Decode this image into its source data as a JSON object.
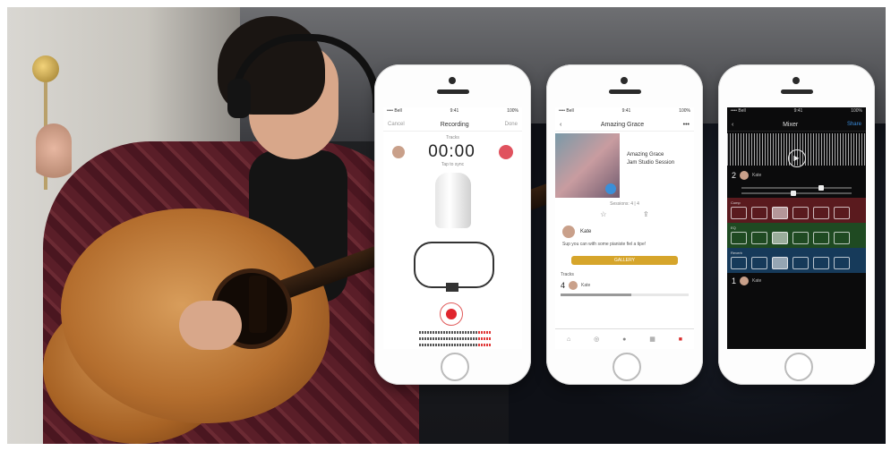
{
  "phone1": {
    "status": {
      "carrier": "•••• Bell",
      "time": "9:41",
      "battery": "100%"
    },
    "nav": {
      "left": "Cancel",
      "title": "Recording",
      "right": "Done"
    },
    "timer_caption": "Tracks",
    "timer": "00:00",
    "timer_sub": "Tap to sync"
  },
  "phone2": {
    "status": {
      "carrier": "•••• Bell",
      "time": "9:41",
      "battery": "100%"
    },
    "nav": {
      "back": "‹",
      "title": "Amazing Grace",
      "subtitle": "Jam Studio Session",
      "more": "•••"
    },
    "song_title": "Amazing Grace",
    "session_name": "Jam Studio Session",
    "plays_line": "Sessions: 4 | 4",
    "user_name": "Kate",
    "comment": "Sup you can with some pianiste fiel a tipe!",
    "gold_button": "GALLERY",
    "tracks_label": "Tracks",
    "track_number": "4",
    "track_user": "Kate",
    "track_progress": 0.55,
    "tabs": [
      "Home",
      "Collaborate",
      "Record",
      "Sessions",
      "Favourites"
    ],
    "active_tab": 4
  },
  "phone3": {
    "status": {
      "carrier": "•••• Bell",
      "time": "9:41",
      "battery": "100%"
    },
    "nav": {
      "back": "‹",
      "title": "Mixer",
      "right": "Share"
    },
    "track_a_number": "2",
    "track_a_user": "Kate",
    "track_b_number": "1",
    "track_b_user": "Kate",
    "banks": [
      {
        "label": "Comp",
        "color": "#5a1a1e",
        "active": 2
      },
      {
        "label": "EQ",
        "color": "#1f4a22",
        "active": 2
      },
      {
        "label": "Reverb",
        "color": "#163a5a",
        "active": 2
      }
    ]
  },
  "colors": {
    "record_red": "#e0262e",
    "gold": "#d6a52b",
    "accent_blue": "#3b8ee0"
  }
}
